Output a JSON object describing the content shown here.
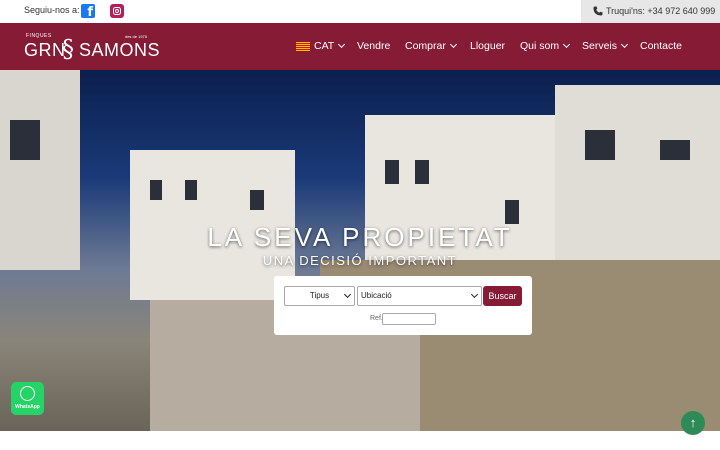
{
  "topbar": {
    "follow_label": "Seguiu-nos a:",
    "facebook_glyph": "f",
    "phone_label": "Truqui'ns:",
    "phone_number": "+34 972 640 999"
  },
  "logo": {
    "small": "FINQUES",
    "since": "des de 1975",
    "left": "GRN",
    "mark": "§",
    "right": "SAMONS"
  },
  "nav": {
    "language": "CAT",
    "items": [
      "Vendre",
      "Comprar",
      "Lloguer",
      "Qui som",
      "Serveis",
      "Contacte"
    ]
  },
  "hero": {
    "title": "LA SEVA PROPIETAT",
    "subtitle": "UNA DECISIÓ IMPORTANT"
  },
  "search": {
    "type_selected": "Tipus",
    "location_selected": "Ubicació",
    "button_label": "Buscar",
    "ref_label": "Ref.:",
    "ref_value": ""
  },
  "whatsapp": {
    "label": "WhatsApp"
  },
  "scroll_top": {
    "glyph": "↑"
  },
  "colors": {
    "brand": "#861b36",
    "whatsapp": "#25d366",
    "scroll_top": "#2e8b57",
    "phone_box": "#e7e7e7"
  },
  "icons": [
    "facebook-icon",
    "instagram-icon",
    "phone-icon",
    "flag-icon",
    "chevron-down-icon",
    "whatsapp-icon",
    "arrow-up-icon"
  ]
}
